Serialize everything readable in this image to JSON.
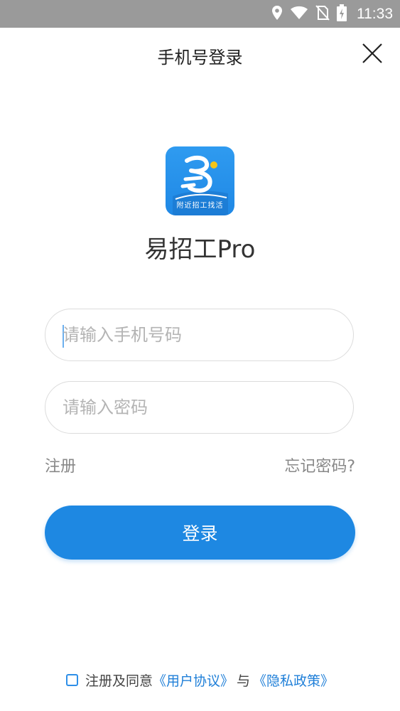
{
  "status_bar": {
    "time": "11:33",
    "icons": [
      "location-icon",
      "wifi-icon",
      "no-sim-icon",
      "battery-charging-icon"
    ],
    "background": "#9a9a9a"
  },
  "header": {
    "title": "手机号登录",
    "close_icon": "close-icon"
  },
  "app": {
    "name": "易招工Pro",
    "logo_caption": "附近招工找活",
    "brand_color": "#1e88e2"
  },
  "form": {
    "phone_placeholder": "请输入手机号码",
    "phone_value": "",
    "password_placeholder": "请输入密码",
    "password_value": ""
  },
  "links": {
    "register": "注册",
    "forgot_password": "忘记密码?"
  },
  "login_button": {
    "label": "登录"
  },
  "agreement": {
    "prefix": "注册及同意",
    "user_agreement": "《用户协议》",
    "connector": "与",
    "privacy_policy": "《隐私政策》",
    "checked": false
  }
}
